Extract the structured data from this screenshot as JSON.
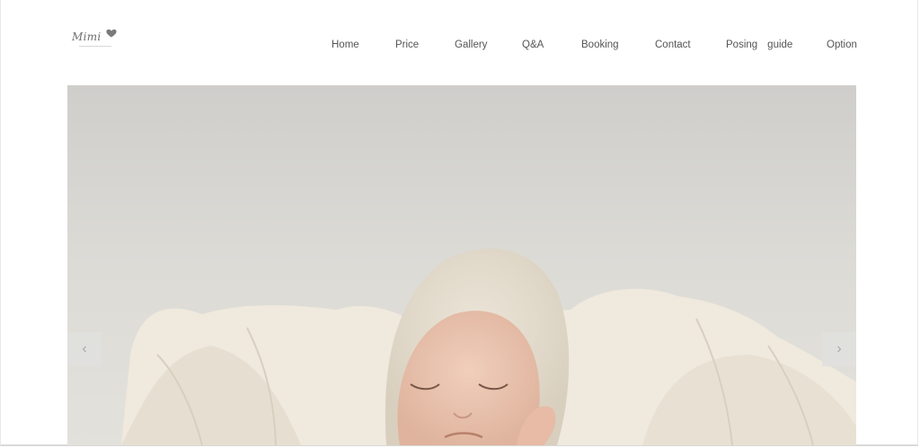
{
  "brand": {
    "logo_text": "Mimi"
  },
  "nav": {
    "items": [
      {
        "id": "home",
        "label": "Home"
      },
      {
        "id": "price",
        "label": "Price"
      },
      {
        "id": "gallery",
        "label": "Gallery"
      },
      {
        "id": "qa",
        "label": "Q&A"
      },
      {
        "id": "booking",
        "label": "Booking"
      },
      {
        "id": "contact",
        "label": "Contact"
      },
      {
        "id": "posing",
        "label_a": "Posing",
        "label_b": "guide"
      },
      {
        "id": "option",
        "label": "Option"
      }
    ]
  },
  "hero": {
    "prev_icon": "chevron-left-icon",
    "next_icon": "chevron-right-icon",
    "prev_glyph": "‹",
    "next_glyph": "›"
  },
  "colors": {
    "nav_text": "#555555",
    "logo_heart": "#7a7a7a",
    "wall": "#d8d7d2",
    "blanket": "#efe9de",
    "bonnet": "#e3dbcc",
    "skin": "#ecc8b3"
  }
}
